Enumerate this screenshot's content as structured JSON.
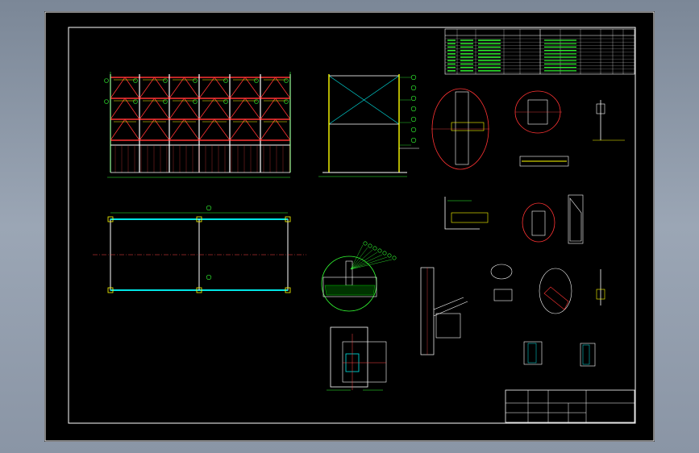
{
  "drawing": {
    "background": "#000000",
    "line_colors": {
      "frame": "#ffffff",
      "steel": "#ffffff",
      "member": "#ff3333",
      "brace": "#00e5e5",
      "dim": "#33ff33",
      "note": "#ffff00",
      "center": "#ff4444",
      "hatch": "#00cc00"
    }
  },
  "title_block": {
    "cells": [
      "",
      "",
      "",
      "",
      "",
      "",
      "",
      ""
    ]
  }
}
